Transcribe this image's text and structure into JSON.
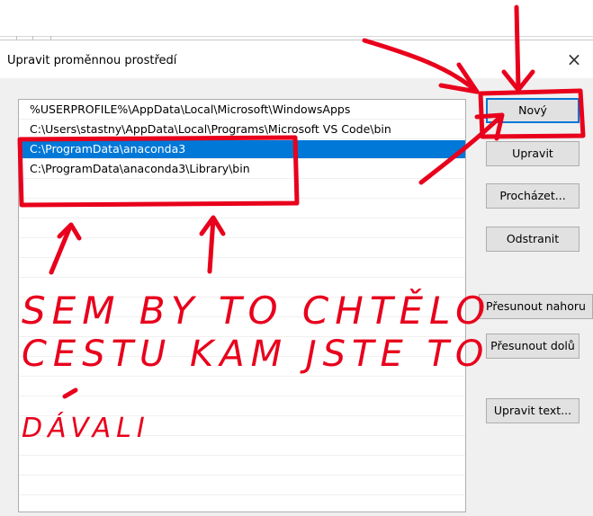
{
  "dialog": {
    "title": "Upravit proměnnou prostředí",
    "close_glyph": "×"
  },
  "list": {
    "items": [
      {
        "text": "%USERPROFILE%\\AppData\\Local\\Microsoft\\WindowsApps",
        "selected": false
      },
      {
        "text": "C:\\Users\\stastny\\AppData\\Local\\Programs\\Microsoft VS Code\\bin",
        "selected": false
      },
      {
        "text": "C:\\ProgramData\\anaconda3",
        "selected": true
      },
      {
        "text": "C:\\ProgramData\\anaconda3\\Library\\bin",
        "selected": false
      }
    ]
  },
  "buttons": {
    "new": "Nový",
    "edit": "Upravit",
    "browse": "Procházet...",
    "delete": "Odstranit",
    "move_up": "Přesunout nahoru",
    "move_down": "Přesunout dolů",
    "edit_text": "Upravit text..."
  },
  "annotation": {
    "color": "#e8001c",
    "lines": [
      "SEM BY TO CHTĚLO",
      "CESTU KAM JSTE TO",
      "DÁVALI"
    ]
  },
  "colors": {
    "selection": "#0078d7",
    "default_button_border": "#0078d7"
  }
}
